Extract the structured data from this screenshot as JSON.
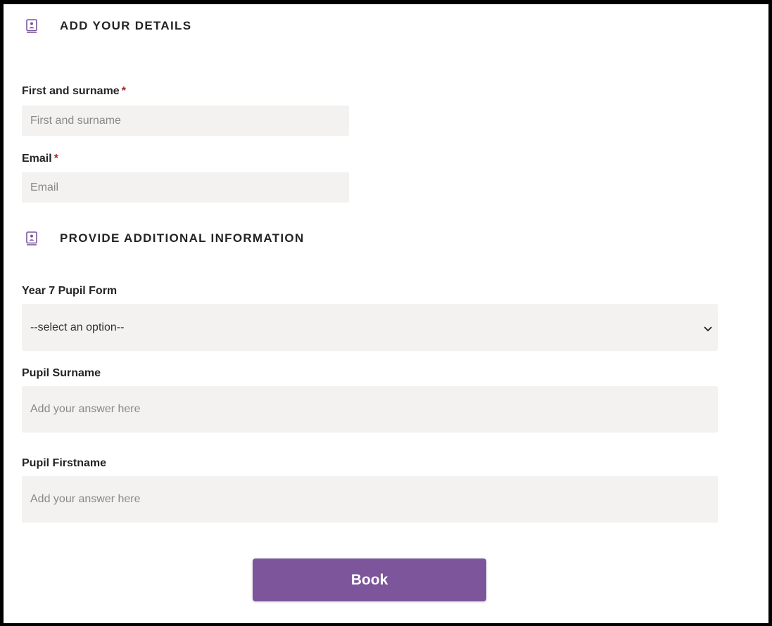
{
  "details_section": {
    "title": "ADD YOUR DETAILS",
    "icon": "contact-card-icon"
  },
  "fields": {
    "name": {
      "label": "First and surname",
      "required_mark": "*",
      "placeholder": "First and surname",
      "value": ""
    },
    "email": {
      "label": "Email",
      "required_mark": "*",
      "placeholder": "Email",
      "value": ""
    }
  },
  "additional_section": {
    "title": "PROVIDE ADDITIONAL INFORMATION",
    "icon": "contact-card-icon"
  },
  "additional": {
    "pupil_form": {
      "label": "Year 7 Pupil Form",
      "selected": "--select an option--"
    },
    "pupil_surname": {
      "label": "Pupil Surname",
      "placeholder": "Add your answer here",
      "value": ""
    },
    "pupil_firstname": {
      "label": "Pupil Firstname",
      "placeholder": "Add your answer here",
      "value": ""
    }
  },
  "book_button": {
    "label": "Book"
  },
  "colors": {
    "accent": "#7c559b",
    "input_bg": "#f3f2f1",
    "required": "#a4262c",
    "frame": "#000000"
  }
}
